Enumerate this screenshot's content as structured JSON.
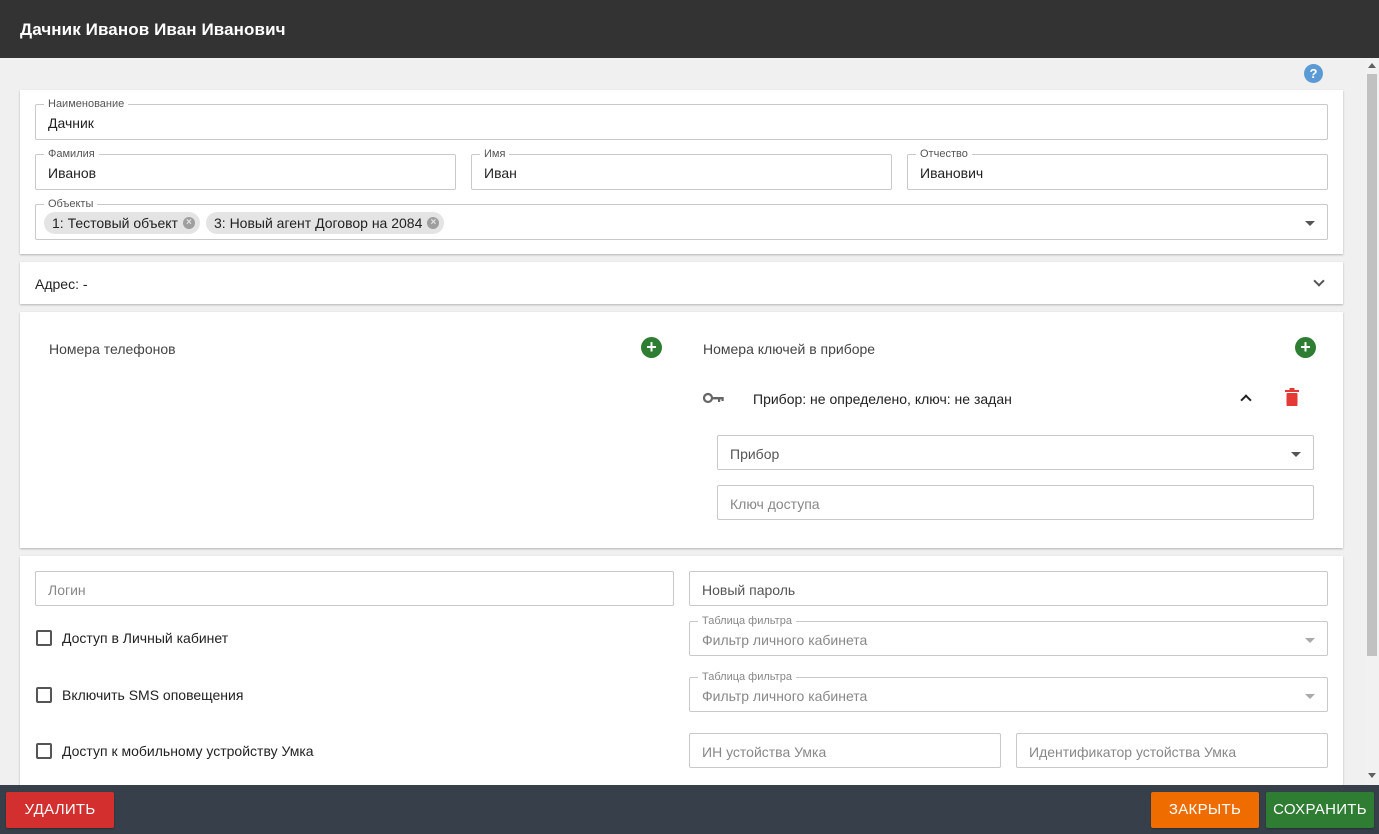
{
  "window": {
    "title": "Дачник Иванов Иван Иванович"
  },
  "general": {
    "name": {
      "label": "Наименование",
      "value": "Дачник"
    },
    "last_name": {
      "label": "Фамилия",
      "value": "Иванов"
    },
    "first_name": {
      "label": "Имя",
      "value": "Иван"
    },
    "middle_name": {
      "label": "Отчество",
      "value": "Иванович"
    },
    "objects": {
      "label": "Объекты",
      "chips": [
        "1: Тестовый объект",
        "3: Новый агент Договор на 2084"
      ]
    }
  },
  "address": {
    "label": "Адрес: -"
  },
  "phones": {
    "label": "Номера телефонов"
  },
  "keys": {
    "label": "Номера ключей в приборе",
    "item_text": "Прибор: не определено, ключ: не задан",
    "device_placeholder": "Прибор",
    "access_key_placeholder": "Ключ доступа"
  },
  "account": {
    "login_placeholder": "Логин",
    "new_password_placeholder": "Новый пароль",
    "cabinet_access_label": "Доступ в Личный кабинет",
    "filter_table_label_1": "Таблица фильтра",
    "filter_placeholder_1": "Фильтр личного кабинета",
    "sms_label": "Включить SMS оповещения",
    "filter_table_label_2": "Таблица фильтра",
    "filter_placeholder_2": "Фильтр личного кабинета",
    "mobile_access_label": "Доступ к мобильному устройству Умка",
    "umka_in_placeholder": "ИН устойства Умка",
    "umka_id_placeholder": "Идентификатор устойства Умка"
  },
  "footer": {
    "delete_label": "УДАЛИТЬ",
    "close_label": "ЗАКРЫТЬ",
    "save_label": "СОХРАНИТЬ"
  },
  "colors": {
    "titlebar": "#333333",
    "footer": "#37404a",
    "delete": "#d32f2f",
    "close": "#ef6c00",
    "save": "#2e7d32",
    "add": "#2e7d32",
    "trash": "#e53935",
    "help": "#5b9bd5"
  },
  "icons": {
    "help": "help-icon",
    "add": "plus-circle-icon",
    "key": "key-icon",
    "trash": "trash-icon",
    "chevron_down": "chevron-down-icon",
    "chevron_up": "chevron-up-icon",
    "chip_remove": "close-circle-icon"
  }
}
